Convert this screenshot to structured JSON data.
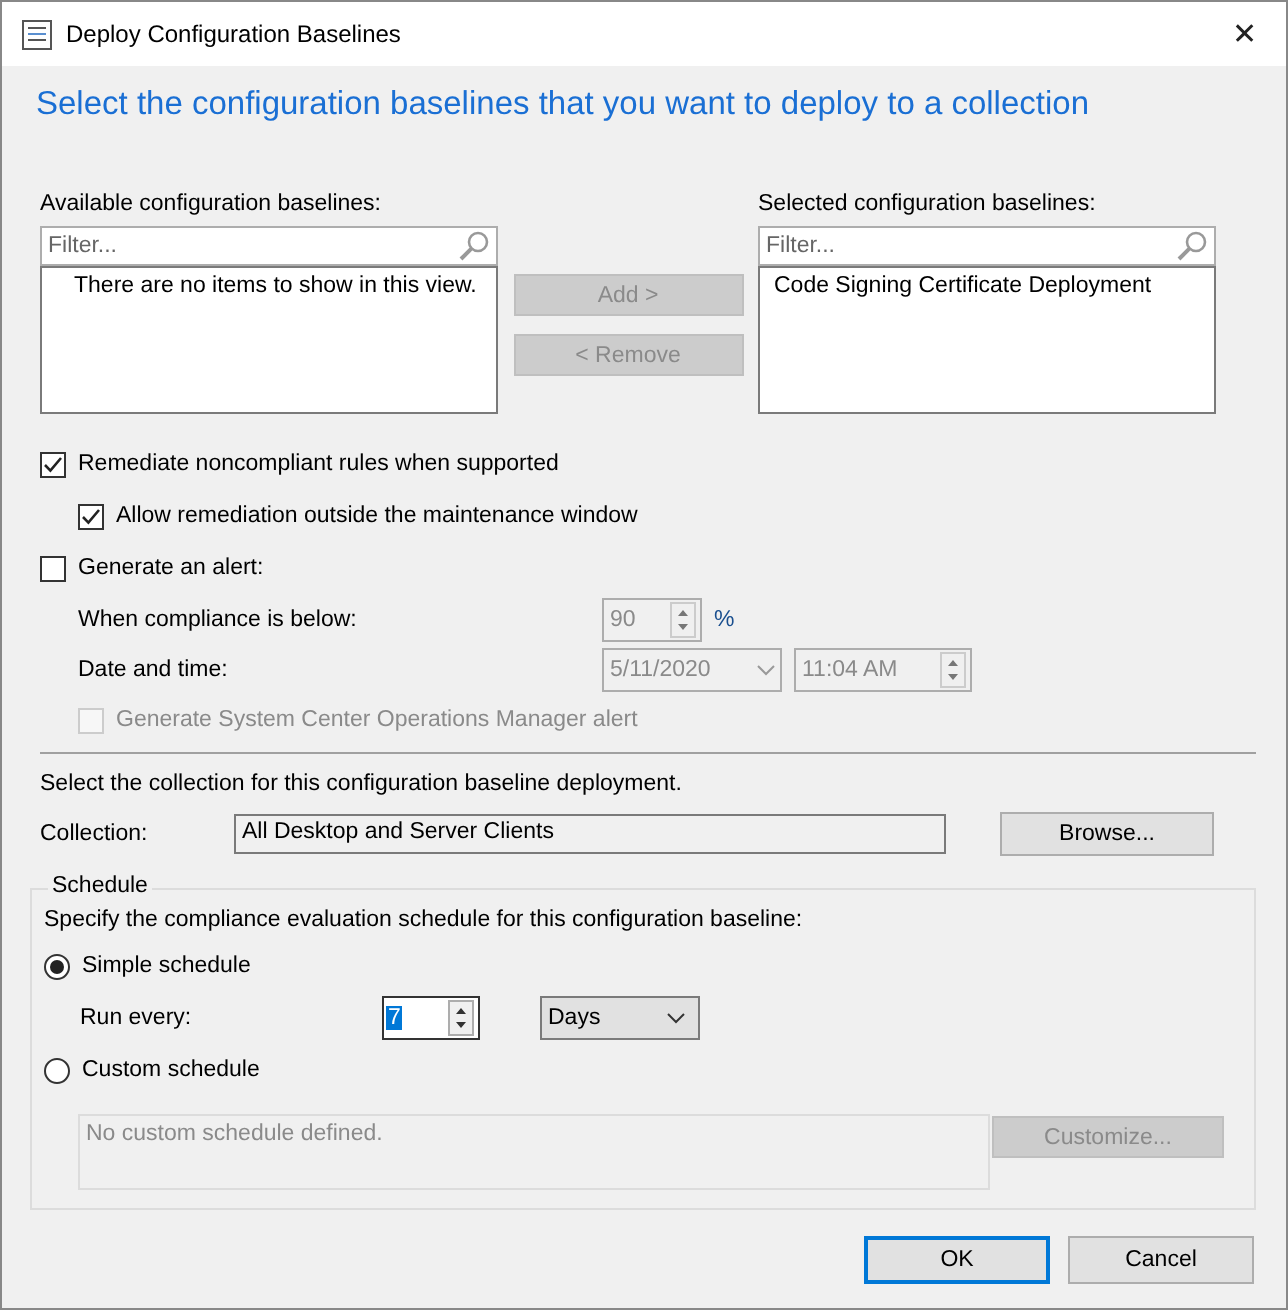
{
  "window": {
    "title": "Deploy Configuration Baselines",
    "close": "✕"
  },
  "heading": "Select the configuration baselines that you want to deploy to a collection",
  "available": {
    "label": "Available configuration baselines:",
    "placeholder": "Filter...",
    "empty_text": "There are no items to show in this view."
  },
  "transfer_buttons": [
    {
      "label": "Add >",
      "disabled": true
    },
    {
      "label": "< Remove",
      "disabled": true
    }
  ],
  "selected": {
    "label": "Selected configuration baselines:",
    "placeholder": "Filter...",
    "items": [
      "Code Signing Certificate Deployment"
    ]
  },
  "options": [
    {
      "label": "Remediate noncompliant rules when supported",
      "checked": true,
      "disabled": false,
      "children": [
        {
          "label": "Allow remediation outside the maintenance window",
          "checked": true,
          "disabled": false
        }
      ]
    },
    {
      "label": "Generate an alert:",
      "checked": false,
      "disabled": false
    }
  ],
  "alert": {
    "disabled": true,
    "compliance_label": "When compliance is below:",
    "compliance_value": "90",
    "unit": "%",
    "date_label": "Date and time:",
    "date": "5/11/2020",
    "time": "11:04 AM",
    "scom": {
      "label": "Generate System Center Operations Manager alert",
      "checked": false,
      "disabled": true
    }
  },
  "collection": {
    "instruction": "Select the collection for this configuration baseline deployment.",
    "label": "Collection:",
    "value": "All Desktop and Server Clients",
    "browse": "Browse..."
  },
  "schedule": {
    "title": "Schedule",
    "instruction": "Specify the compliance evaluation schedule for this configuration baseline:",
    "options": [
      {
        "label": "Simple schedule",
        "selected": true
      },
      {
        "label": "Custom schedule",
        "selected": false
      }
    ],
    "run_every_label": "Run every:",
    "run_every_value": "7",
    "run_every_unit": "Days",
    "custom_text": "No custom schedule defined.",
    "customize": {
      "label": "Customize...",
      "disabled": true
    }
  },
  "footer": [
    {
      "label": "OK",
      "default": true
    },
    {
      "label": "Cancel",
      "default": false
    }
  ]
}
